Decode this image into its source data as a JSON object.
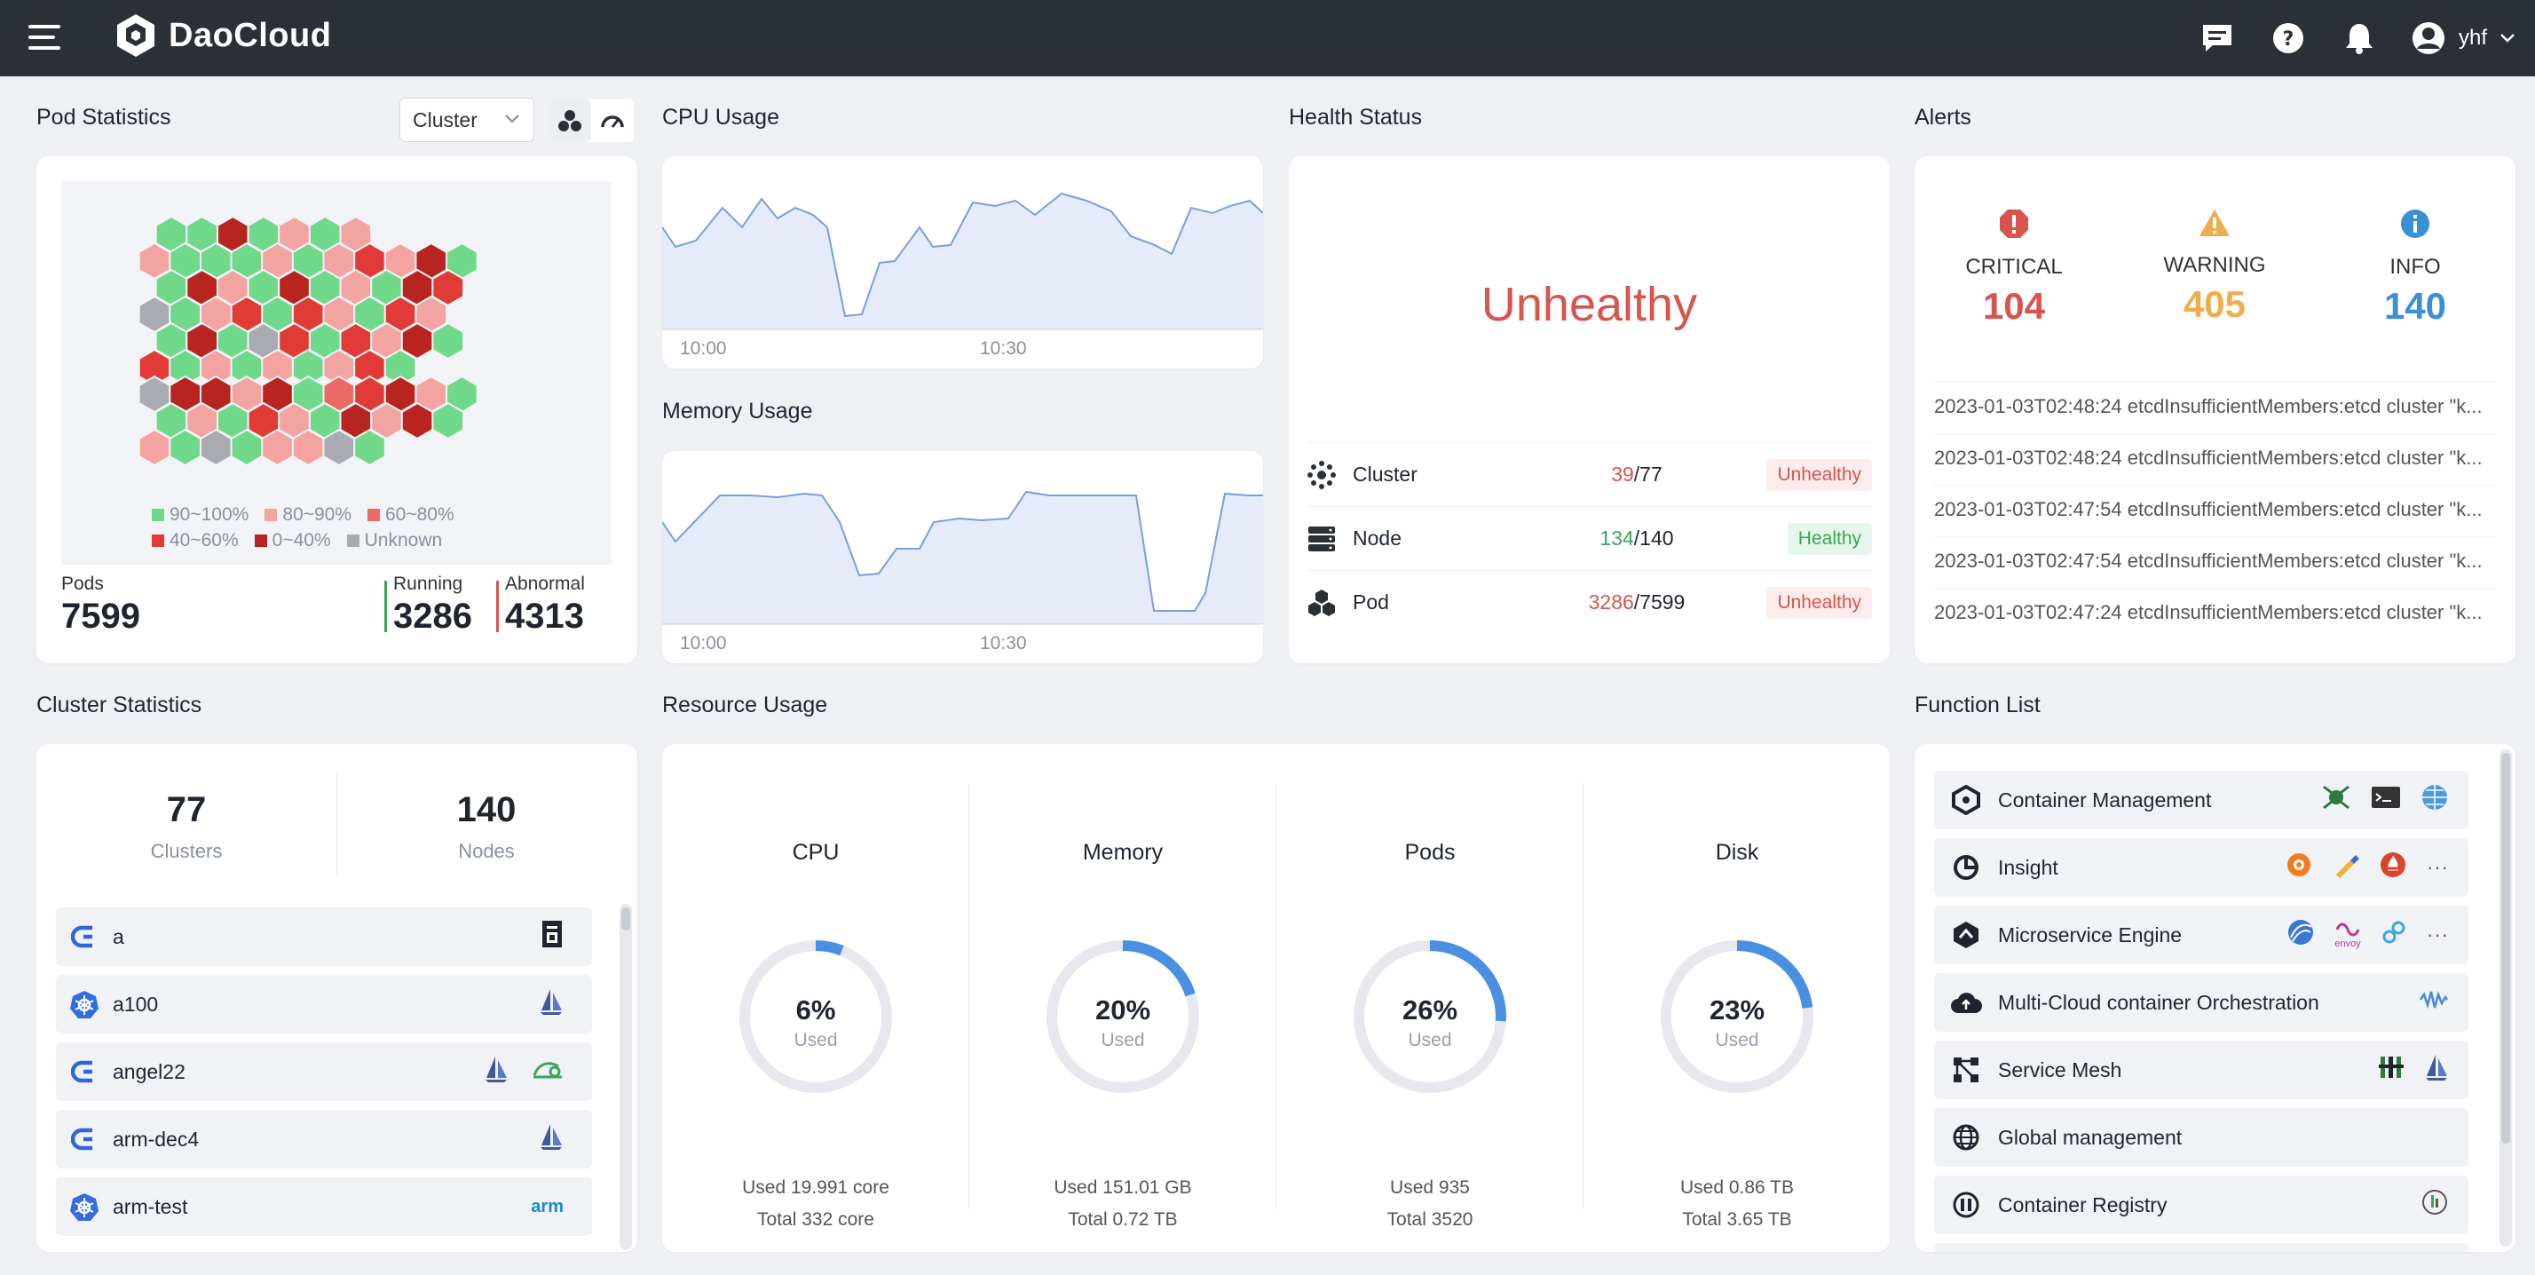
{
  "app": {
    "brand": "DaoCloud",
    "user": "yhf"
  },
  "colors": {
    "topbar": "#2b2f36",
    "critical": "#d9534f",
    "warning": "#f0ad4e",
    "info": "#3b8fd6",
    "healthy": "#3aa55a",
    "accent": "#4a90e2"
  },
  "pod_stats": {
    "title": "Pod Statistics",
    "view_select": "Cluster",
    "legend": [
      "90~100%",
      "80~90%",
      "60~80%",
      "40~60%",
      "0~40%",
      "Unknown"
    ],
    "pods_label": "Pods",
    "pods_value": "7599",
    "running_label": "Running",
    "running_value": "3286",
    "abnormal_label": "Abnormal",
    "abnormal_value": "4313"
  },
  "cpu_usage": {
    "title": "CPU Usage",
    "ticks": [
      "10:00",
      "10:30"
    ]
  },
  "memory_usage": {
    "title": "Memory Usage",
    "ticks": [
      "10:00",
      "10:30"
    ]
  },
  "health": {
    "title": "Health Status",
    "status": "Unhealthy",
    "rows": [
      {
        "name": "Cluster",
        "bad": "39",
        "total": "/77",
        "badge": "Unhealthy"
      },
      {
        "name": "Node",
        "bad": "134",
        "total": "/140",
        "badge": "Healthy"
      },
      {
        "name": "Pod",
        "bad": "3286",
        "total": "/7599",
        "badge": "Unhealthy"
      }
    ]
  },
  "alerts": {
    "title": "Alerts",
    "critical_label": "CRITICAL",
    "critical_value": "104",
    "warning_label": "WARNING",
    "warning_value": "405",
    "info_label": "INFO",
    "info_value": "140",
    "lines": [
      "2023-01-03T02:48:24 etcdInsufficientMembers:etcd cluster \"k...",
      "2023-01-03T02:48:24 etcdInsufficientMembers:etcd cluster \"k...",
      "2023-01-03T02:47:54 etcdInsufficientMembers:etcd cluster \"k...",
      "2023-01-03T02:47:54 etcdInsufficientMembers:etcd cluster \"k...",
      "2023-01-03T02:47:24 etcdInsufficientMembers:etcd cluster \"k..."
    ]
  },
  "cluster_stats": {
    "title": "Cluster Statistics",
    "clusters_value": "77",
    "clusters_label": "Clusters",
    "nodes_value": "140",
    "nodes_label": "Nodes",
    "items": [
      {
        "name": "a",
        "icon": "daocloud-icon",
        "tags": [
          "storage-icon"
        ]
      },
      {
        "name": "a100",
        "icon": "kubernetes-icon",
        "tags": [
          "sail-icon"
        ]
      },
      {
        "name": "angel22",
        "icon": "daocloud-icon",
        "tags": [
          "sail-icon",
          "network-icon"
        ]
      },
      {
        "name": "arm-dec4",
        "icon": "daocloud-icon",
        "tags": [
          "sail-icon"
        ]
      },
      {
        "name": "arm-test",
        "icon": "kubernetes-icon",
        "tags": [
          "arm"
        ]
      }
    ]
  },
  "resource": {
    "title": "Resource Usage",
    "used_word": "Used",
    "items": [
      {
        "name": "CPU",
        "pct": "6%",
        "pct_value": 6,
        "line1": "Used 19.991 core",
        "line2": "Total 332 core"
      },
      {
        "name": "Memory",
        "pct": "20%",
        "pct_value": 20,
        "line1": "Used 151.01 GB",
        "line2": "Total 0.72 TB"
      },
      {
        "name": "Pods",
        "pct": "26%",
        "pct_value": 26,
        "line1": "Used 935",
        "line2": "Total 3520"
      },
      {
        "name": "Disk",
        "pct": "23%",
        "pct_value": 23,
        "line1": "Used 0.86 TB",
        "line2": "Total 3.65 TB"
      }
    ]
  },
  "functions": {
    "title": "Function List",
    "items": [
      {
        "name": "Container Management",
        "icon": "container-mgmt-icon",
        "more": ""
      },
      {
        "name": "Insight",
        "icon": "insight-icon",
        "more": "···"
      },
      {
        "name": "Microservice Engine",
        "icon": "microservice-icon",
        "more": "···"
      },
      {
        "name": "Multi-Cloud container Orchestration",
        "icon": "multicloud-icon",
        "more": ""
      },
      {
        "name": "Service Mesh",
        "icon": "mesh-icon",
        "more": ""
      },
      {
        "name": "Global management",
        "icon": "globe-icon",
        "more": ""
      },
      {
        "name": "Container Registry",
        "icon": "registry-icon",
        "more": ""
      }
    ],
    "envoy_label": "envoy"
  }
}
